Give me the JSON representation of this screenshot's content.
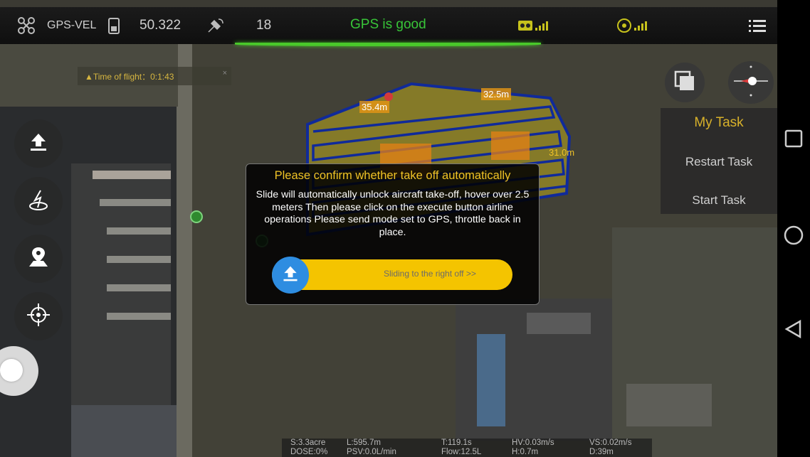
{
  "topbar": {
    "mode": "GPS-VEL",
    "battery_value": "50.322",
    "satellites": "18",
    "gps_status": "GPS is good",
    "colors": {
      "gps_good": "#38c538",
      "accent": "#d8b12a"
    }
  },
  "flight_banner": {
    "text": "▲Time of flight：0:1:43",
    "close": "×"
  },
  "map_labels": {
    "l1": "35.4m",
    "l2": "32.5m",
    "l3": "31.0m"
  },
  "task_panel": {
    "title": "My Task",
    "restart": "Restart Task",
    "start": "Start Task"
  },
  "dialog": {
    "title": "Please confirm whether take off automatically",
    "message": "Slide will automatically unlock aircraft take-off, hover over 2.5 meters Then please click on the execute button airline operations Please send mode set to GPS, throttle back in place.",
    "slider_label": "Sliding to the right off >>"
  },
  "stats": {
    "s": "S:3.3acre",
    "dose": "DOSE:0%",
    "l": "L:595.7m",
    "psv": "PSV:0.0L/min",
    "t": "T:119.1s",
    "flow": "Flow:12.5L",
    "hv": "HV:0.03m/s",
    "h": "H:0.7m",
    "vs": "VS:0.02m/s",
    "d": "D:39m"
  },
  "icons": [
    "drone-icon",
    "battery-icon",
    "satellite-icon",
    "remote-signal-icon",
    "link-signal-icon",
    "menu-icon",
    "upload-icon",
    "takeoff-icon",
    "location-icon",
    "crosshair-icon",
    "layers-icon",
    "compass-icon",
    "square-icon",
    "circle-icon",
    "back-triangle-icon"
  ]
}
